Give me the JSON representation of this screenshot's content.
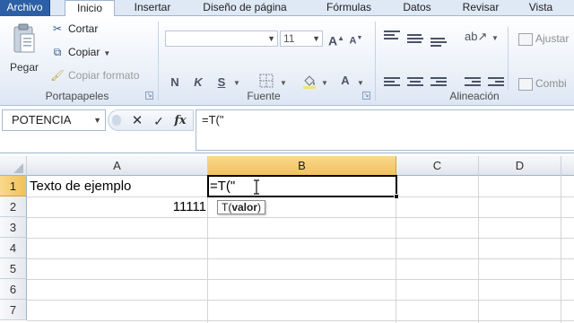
{
  "ribbon_tabs": {
    "file": "Archivo",
    "home": "Inicio",
    "insert": "Insertar",
    "page_layout": "Diseño de página",
    "formulas": "Fórmulas",
    "data": "Datos",
    "review": "Revisar",
    "view": "Vista"
  },
  "clipboard": {
    "paste": "Pegar",
    "cut": "Cortar",
    "copy": "Copiar",
    "format_painter": "Copiar formato",
    "group_label": "Portapapeles"
  },
  "font": {
    "name": "",
    "size": "11",
    "bold": "N",
    "italic": "K",
    "underline": "S",
    "font_color_glyph": "A",
    "group_label": "Fuente"
  },
  "alignment": {
    "wrap_text": "Ajustar",
    "merge_center": "Combi",
    "group_label": "Alineación"
  },
  "formula_bar": {
    "name_box": "POTENCIA",
    "cancel_glyph": "✕",
    "enter_glyph": "✓",
    "fx_glyph": "fx",
    "content": "=T(\""
  },
  "columns": [
    "A",
    "B",
    "C",
    "D"
  ],
  "rows": [
    "1",
    "2",
    "3",
    "4",
    "5",
    "6",
    "7"
  ],
  "cells": {
    "A1": "Texto de ejemplo",
    "A2": "11111",
    "B1": "=T(\""
  },
  "tooltip": {
    "prefix": "T(",
    "arg": "valor",
    "suffix": ")"
  },
  "colors": {
    "file_tab": "#2c5fa5",
    "active_header": "#f1c05b",
    "ribbon_bg": "#dfe8f5"
  }
}
